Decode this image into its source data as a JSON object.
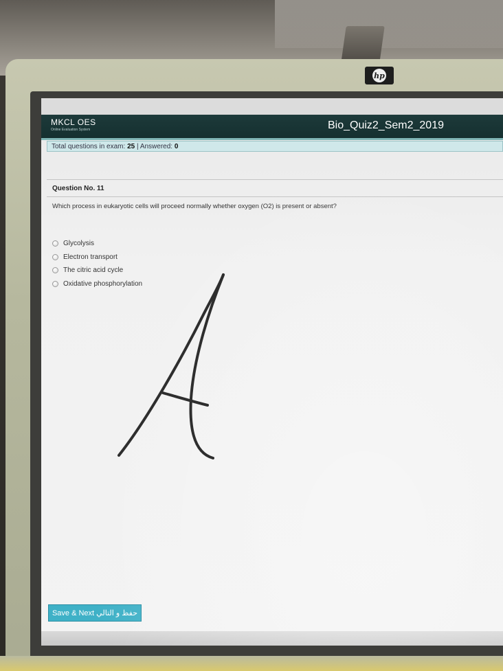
{
  "screen": {
    "brand": {
      "name": "MKCL OES",
      "subtitle": "Online Evaluation System"
    },
    "exam_title": "Bio_Quiz2_Sem2_2019",
    "status": {
      "total_label": "Total questions in exam:",
      "total_value": "25",
      "separator": "|",
      "answered_label": "Answered:",
      "answered_value": "0"
    },
    "question": {
      "heading": "Question No. 11",
      "text": "Which process in eukaryotic cells will proceed normally whether oxygen (O2) is present or absent?",
      "options": [
        "Glycolysis",
        "Electron transport",
        "The citric acid cycle",
        "Oxidative phosphorylation"
      ]
    },
    "save_button_label": "Save & Next حفظ و التالي"
  },
  "colors": {
    "header_bg": "#1d3a3a",
    "status_bg": "#cfe8ea",
    "button_bg": "#3fb1c7"
  },
  "icons": {
    "monitor_logo": "hp-logo-icon",
    "option_marker": "radio-icon"
  }
}
